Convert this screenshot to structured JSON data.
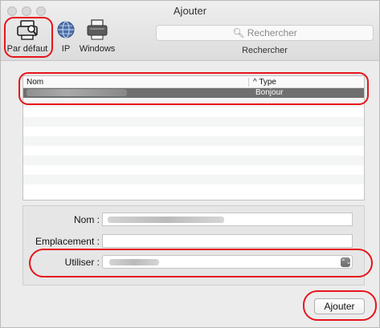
{
  "window": {
    "title": "Ajouter"
  },
  "toolbar": {
    "tools": [
      {
        "label": "Par défaut",
        "icon": "default-printer-icon"
      },
      {
        "label": "IP",
        "icon": "globe-icon"
      },
      {
        "label": "Windows",
        "icon": "windows-printer-icon"
      }
    ],
    "search_placeholder": "Rechercher",
    "search_caption": "Rechercher"
  },
  "list": {
    "columns": [
      "Nom",
      "Type"
    ],
    "sort_indicator": "^",
    "rows": [
      {
        "name": "",
        "type": "Bonjour",
        "selected": true
      }
    ]
  },
  "form": {
    "name_label": "Nom :",
    "location_label": "Emplacement :",
    "use_label": "Utiliser :",
    "stepper_glyph": "⌃⌄"
  },
  "footer": {
    "add_button": "Ajouter"
  },
  "colors": {
    "annotation": "#e8141b",
    "selection": "#6f6f6f"
  }
}
